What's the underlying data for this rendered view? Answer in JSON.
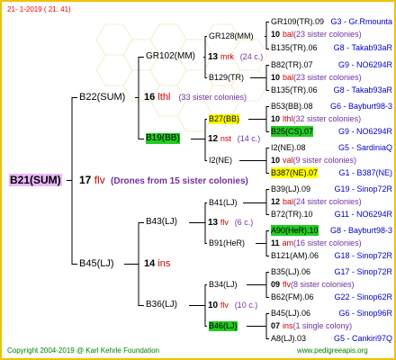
{
  "header": {
    "text": "21-  1-2019 (  21:  41)"
  },
  "footer": {
    "left": "Copyright 2004-2019 @ Karl Kehrle Foundation",
    "right": "www.pedigreeapis.org"
  },
  "root": {
    "code": "B21(SUM)",
    "number": "17",
    "abbr": "flv",
    "note": "(Drones from 15 sister colonies)"
  },
  "g2": {
    "top": {
      "code": "B22(SUM)",
      "number": "16",
      "abbr": "lthl",
      "note": "(33 sister colonies)"
    },
    "bottom": {
      "code": "B45(LJ)",
      "number": "14",
      "abbr": "ins"
    }
  },
  "g3": [
    {
      "code": "GR102(MM)",
      "number": "13",
      "abbr": "mrk",
      "note": "(24 c.)"
    },
    {
      "code": "B19(BB)",
      "number": "12",
      "abbr": "nst",
      "note": "(14 c.)"
    },
    {
      "code": "B43(LJ)",
      "number": "13",
      "abbr": "flv",
      "note": "(6 c.)"
    },
    {
      "code": "B36(LJ)",
      "number": "10",
      "abbr": "flv",
      "note": "(10 c.)"
    }
  ],
  "g4": [
    "GR128(MM)",
    "B129(TR)",
    "B27(BB)",
    "I2(NE)",
    "B41(LJ)",
    "B91(HeR)",
    "B34(LJ)",
    "B46(LJ)"
  ],
  "g5": [
    {
      "left": "GR109(TR).09",
      "right": "G3 - Gr.Rmounta"
    },
    {
      "num": "10",
      "abbr": "bal",
      "note": "(23 sister colonies)"
    },
    {
      "left": "B135(TR).06",
      "right": "G8 - Takab93aR"
    },
    {
      "left": "B82(TR).07",
      "right": "G9 - NO6294R"
    },
    {
      "num": "10",
      "abbr": "bal",
      "note": "(23 sister colonies)"
    },
    {
      "left": "B135(TR).06",
      "right": "G8 - Takab93aR"
    },
    {
      "left": "B53(BB).08",
      "right": "G6 - Bayburt98-3"
    },
    {
      "num": "10",
      "abbr": "lthl",
      "note": "(32 sister colonies)"
    },
    {
      "left": "B25(CS).07",
      "right": "G9 - NO6294R"
    },
    {
      "left": "I2(NE).08",
      "right": "G5 - SardiniaQ"
    },
    {
      "num": "10",
      "abbr": "val",
      "note": "(9 sister colonies)"
    },
    {
      "left": "B387(NE).07",
      "right": "G1 - B387(NE)"
    },
    {
      "left": "B39(LJ).09",
      "right": "G19 - Sinop72R"
    },
    {
      "num": "12",
      "abbr": "bal",
      "note": "(24 sister colonies)"
    },
    {
      "left": "B72(TR).10",
      "right": "G11 - NO6294R"
    },
    {
      "left": "A90(HeR).10",
      "right": "G8 - Bayburt98-3"
    },
    {
      "num": "11",
      "abbr": "am",
      "note": "(16 sister colonies)"
    },
    {
      "left": "B121(AM).06",
      "right": "G18 - Sinop72R"
    },
    {
      "left": "B35(LJ).06",
      "right": "G17 - Sinop72R"
    },
    {
      "num": "09",
      "abbr": "flv",
      "note": "(8 sister colonies)"
    },
    {
      "left": "B62(FM).06",
      "right": "G22 - Sinop62R"
    },
    {
      "left": "B45(LJ).06",
      "right": "G6 - Sinop96R"
    },
    {
      "num": "07",
      "abbr": "ins",
      "note": "(1 single colony)"
    },
    {
      "left": "A8(LJ).03",
      "right": "G5 - Cankiri97Q"
    }
  ],
  "colors": {
    "border": "#f0c000",
    "header": "#ff0000",
    "footer": "#008000",
    "highlight_green": "#22cc22",
    "highlight_yellow": "#ffff00",
    "highlight_purple": "#e8b8f8",
    "note": "#7030a0",
    "right_code": "#0000cc"
  }
}
